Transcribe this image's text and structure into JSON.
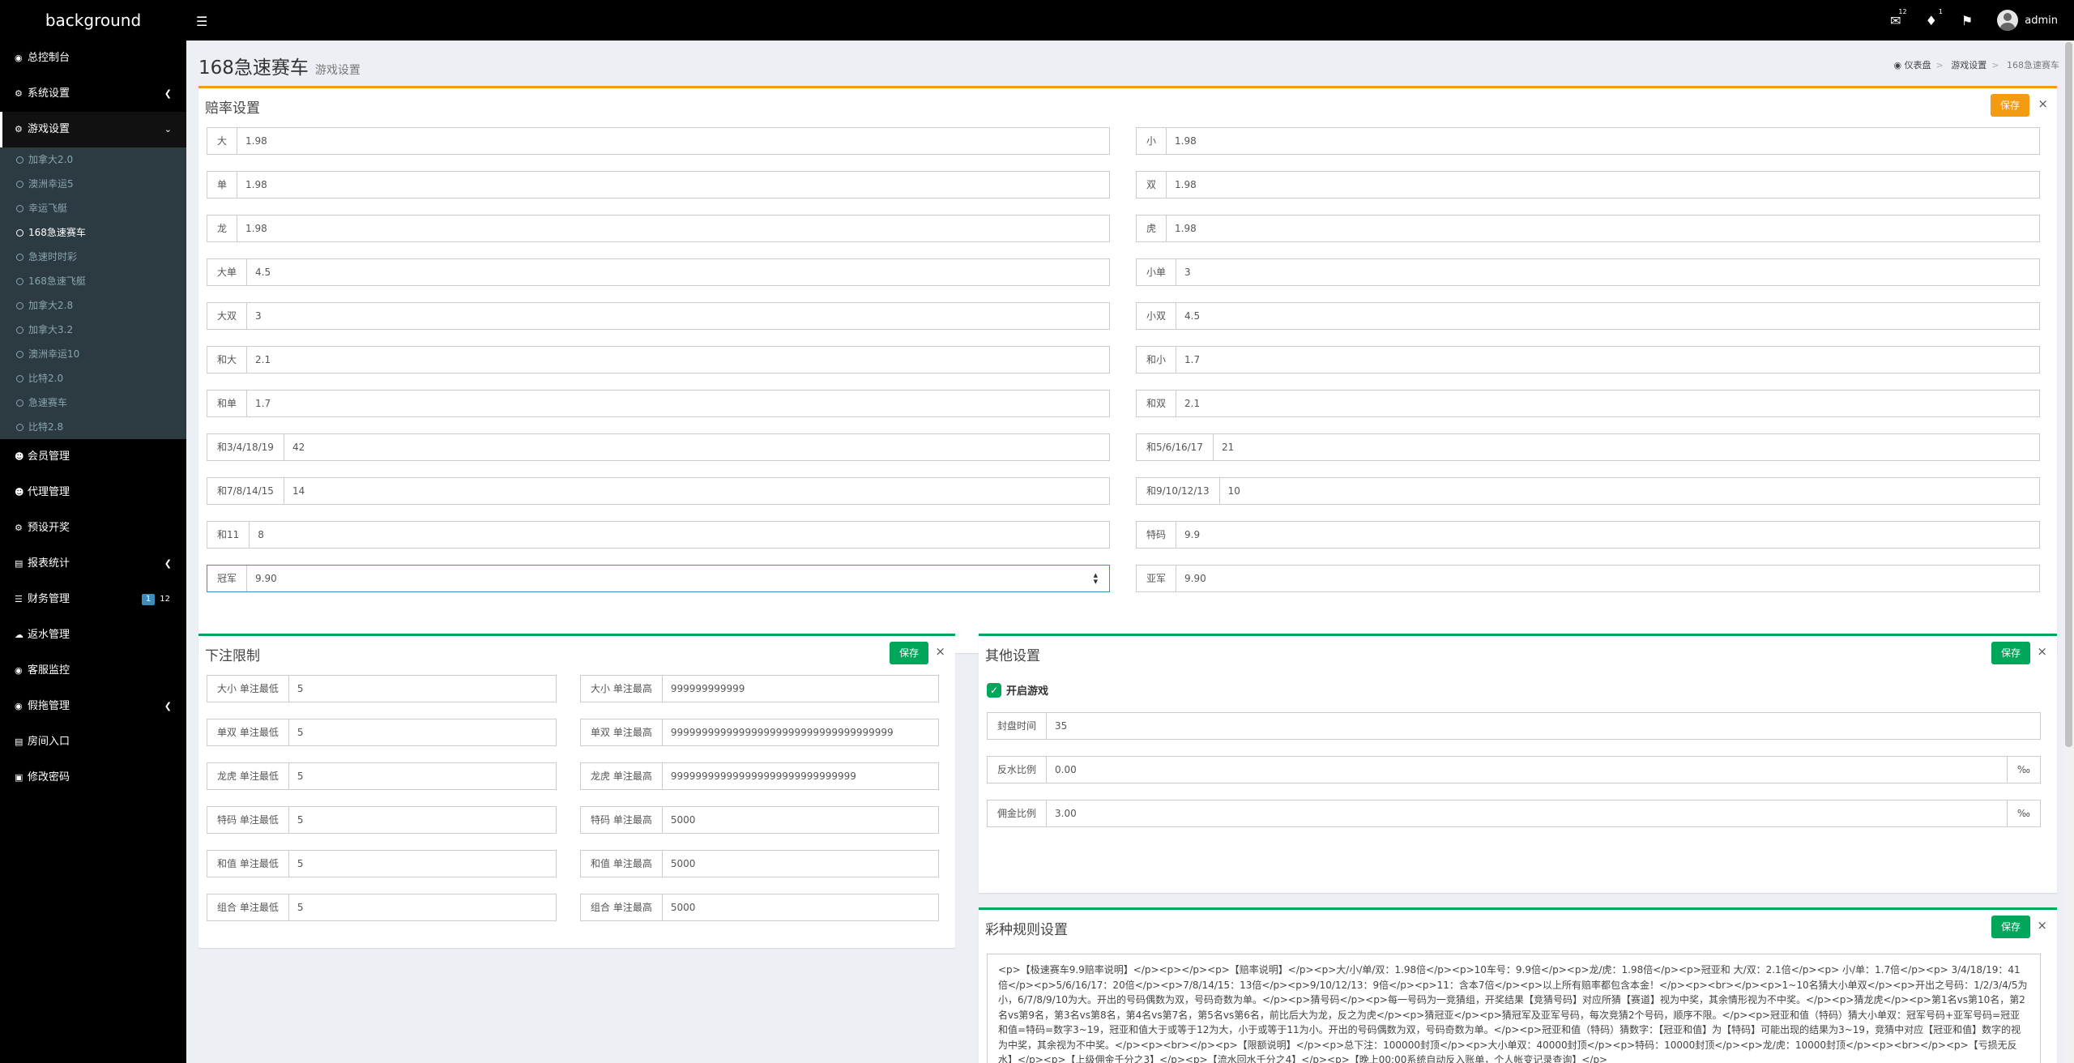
{
  "header": {
    "logo": "background",
    "user": "admin",
    "mail_count": "12",
    "bell_count": "1"
  },
  "sidebar": {
    "items": [
      {
        "label": "总控制台"
      },
      {
        "label": "系统设置"
      },
      {
        "label": "游戏设置"
      },
      {
        "label": "会员管理"
      },
      {
        "label": "代理管理"
      },
      {
        "label": "预设开奖"
      },
      {
        "label": "报表统计"
      },
      {
        "label": "财务管理",
        "badge1": "1",
        "badge2": "12"
      },
      {
        "label": "返水管理"
      },
      {
        "label": "客服监控"
      },
      {
        "label": "假拖管理"
      },
      {
        "label": "房间入口"
      },
      {
        "label": "修改密码"
      }
    ],
    "sub_items": [
      "加拿大2.0",
      "澳洲幸运5",
      "幸运飞艇",
      "168急速赛车",
      "急速时时彩",
      "168急速飞艇",
      "加拿大2.8",
      "加拿大3.2",
      "澳洲幸运10",
      "比特2.0",
      "急速赛车",
      "比特2.8"
    ]
  },
  "page": {
    "title": "168急速赛车",
    "subtitle": "游戏设置"
  },
  "breadcrumb": [
    "仪表盘",
    "游戏设置",
    "168急速赛车"
  ],
  "odds": {
    "title": "赔率设置",
    "save": "保存",
    "close": "×",
    "left": [
      {
        "label": "大",
        "value": "1.98"
      },
      {
        "label": "单",
        "value": "1.98"
      },
      {
        "label": "龙",
        "value": "1.98"
      },
      {
        "label": "大单",
        "value": "4.5"
      },
      {
        "label": "大双",
        "value": "3"
      },
      {
        "label": "和大",
        "value": "2.1"
      },
      {
        "label": "和单",
        "value": "1.7"
      },
      {
        "label": "和3/4/18/19",
        "value": "42"
      },
      {
        "label": "和7/8/14/15",
        "value": "14"
      },
      {
        "label": "和11",
        "value": "8"
      },
      {
        "label": "冠军",
        "value": "9.90"
      }
    ],
    "right": [
      {
        "label": "小",
        "value": "1.98"
      },
      {
        "label": "双",
        "value": "1.98"
      },
      {
        "label": "虎",
        "value": "1.98"
      },
      {
        "label": "小单",
        "value": "3"
      },
      {
        "label": "小双",
        "value": "4.5"
      },
      {
        "label": "和小",
        "value": "1.7"
      },
      {
        "label": "和双",
        "value": "2.1"
      },
      {
        "label": "和5/6/16/17",
        "value": "21"
      },
      {
        "label": "和9/10/12/13",
        "value": "10"
      },
      {
        "label": "特码",
        "value": "9.9"
      },
      {
        "label": "亚军",
        "value": "9.90"
      }
    ]
  },
  "limits": {
    "title": "下注限制",
    "save": "保存",
    "close": "×",
    "left": [
      {
        "label": "大小 单注最低",
        "value": "5"
      },
      {
        "label": "单双 单注最低",
        "value": "5"
      },
      {
        "label": "龙虎 单注最低",
        "value": "5"
      },
      {
        "label": "特码 单注最低",
        "value": "5"
      },
      {
        "label": "和值 单注最低",
        "value": "5"
      },
      {
        "label": "组合 单注最低",
        "value": "5"
      }
    ],
    "right": [
      {
        "label": "大小 单注最高",
        "value": "999999999999"
      },
      {
        "label": "单双 单注最高",
        "value": "999999999999999999999999999999999999"
      },
      {
        "label": "龙虎 单注最高",
        "value": "999999999999999999999999999999"
      },
      {
        "label": "特码 单注最高",
        "value": "5000"
      },
      {
        "label": "和值 单注最高",
        "value": "5000"
      },
      {
        "label": "组合 单注最高",
        "value": "5000"
      }
    ]
  },
  "other": {
    "title": "其他设置",
    "save": "保存",
    "close": "×",
    "enable_label": "开启游戏",
    "fields": [
      {
        "label": "封盘时间",
        "value": "35",
        "unit": ""
      },
      {
        "label": "反水比例",
        "value": "0.00",
        "unit": "‰"
      },
      {
        "label": "佣金比例",
        "value": "3.00",
        "unit": "‰"
      }
    ]
  },
  "rules": {
    "title": "彩种规则设置",
    "save": "保存",
    "close": "×",
    "text": "<p>【极速赛车9.9赔率说明】</p><p></p><p>【赔率说明】</p><p>大/小/单/双：1.98倍</p><p>10车号：9.9倍</p><p>龙/虎：1.98倍</p><p>冠亚和 大/双：2.1倍</p><p>      小/单：1.7倍</p><p> 3/4/18/19：41倍</p><p>5/6/16/17：20倍</p><p>7/8/14/15：13倍</p><p>9/10/12/13：9倍</p><p>11：含本7倍</p><p>以上所有赔率都包含本金！</p><p><br></p><p>1~10名猜大小单双</p><p>开出之号码：1/2/3/4/5为小，6/7/8/9/10为大。开出的号码偶数为双，号码奇数为单。</p><p>猜号码</p><p>每一号码为一竞猜组，开奖结果【竞猜号码】对应所猜【赛道】视为中奖，其余情形视为不中奖。</p><p>猜龙虎</p><p>第1名vs第10名，第2名vs第9名，第3名vs第8名，第4名vs第7名，第5名vs第6名，前比后大为龙，反之为虎</p><p>猜冠亚</p><p>猜冠军及亚军号码，每次竞猜2个号码，顺序不限。</p><p>冠亚和值（特码）猜大小单双：冠军号码+亚军号码=冠亚和值=特码=数字3~19，冠亚和值大于或等于12为大，小于或等于11为小。开出的号码偶数为双，号码奇数为单。</p><p>冠亚和值（特码）猜数字：【冠亚和值】为【特码】可能出现的结果为3~19，竞猜中对应【冠亚和值】数字的视为中奖，其余视为不中奖。</p><p><br></p><p>【限额说明】</p><p>总下注：100000封顶</p><p>大小单双：40000封顶</p><p>特码：10000封顶</p><p>龙/虎：10000封顶</p><p><br></p><p>【亏损无反水】</p><p>【上级佣金千分之3】</p><p>【流水回水千分之4】</p><p>【晚上00:00系统自动反入账单，个人帐变记录查询】</p>"
  }
}
